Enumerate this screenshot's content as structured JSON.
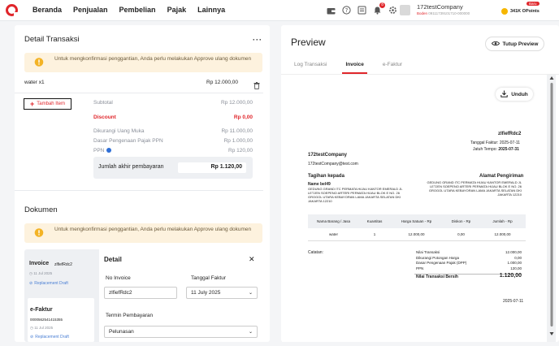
{
  "nav": [
    "Beranda",
    "Penjualan",
    "Pembelian",
    "Pajak",
    "Lainnya"
  ],
  "topbar": {
    "notif_count": "8",
    "company_name": "172testCompany",
    "company_role": "Boden",
    "company_id": "09111739101710-000000",
    "points": "341K OPoints",
    "new_badge": "Baru"
  },
  "left": {
    "title": "Detail Transaksi",
    "menu": "···",
    "alert1": "Untuk mengkonfirmasi penggantian, Anda perlu melakukan Approve ulang dokumen",
    "item_name": "water  x1",
    "item_price": "Rp 12.000,00",
    "add_item": "Tambah Item",
    "summary": [
      {
        "label": "Subtotal",
        "value": "Rp 12.000,00",
        "red": false
      },
      {
        "label": "Discount",
        "value": "Rp 0,00",
        "red": true
      },
      {
        "label": "Dikurangi Uang Muka",
        "value": "Rp 11.000,00",
        "red": false
      },
      {
        "label": "Dasar Pengenaan Pajak PPN",
        "value": "Rp 1.000,00",
        "red": false
      },
      {
        "label": "PPN",
        "value": "Rp 120,00",
        "red": false
      }
    ],
    "total_label": "Jumlah akhir pembayaran",
    "total_value": "Rp 1.120,00",
    "dokumen_title": "Dokumen",
    "alert2": "Untuk mengkonfirmasi penggantian, Anda perlu melakukan Approve ulang dokumen",
    "invoice_label": "Invoice",
    "invoice_code": "zlfiefRdc2",
    "invoice_date": "11 Jul 2025",
    "replacement": "Replacement Draft",
    "efaktur_label": "e-Faktur",
    "efaktur_no": "0000562541415355",
    "efaktur_date": "11 Jul 2025",
    "detail_title": "Detail",
    "no_invoice_label": "No Invoice",
    "no_invoice_value": "zlfiefRdc2",
    "tgl_faktur_label": "Tanggal Faktur",
    "tgl_faktur_value": "11 July 2025",
    "termin_label": "Termin Pembayaran",
    "termin_value": "Pelunasan"
  },
  "right": {
    "title": "Preview",
    "tutup": "Tutup Preview",
    "tabs": [
      "Log Transaksi",
      "Invoice",
      "e-Faktur"
    ],
    "unduh": "Unduh",
    "doc": {
      "inv_no": "zlfiefRdc2",
      "tgl_faktur": "Tanggal Faktur: 2025-07-11",
      "jatuh_tempo_label": "Jatuh Tempo:",
      "jatuh_tempo": "2025-07-31",
      "company": "172testCompany",
      "email": "172testCompany@test.com",
      "tagihan_label": "Tagihan kepada",
      "alamat_label": "Alamat Pengiriman",
      "buyer_name": "Name bel49",
      "buyer_addr": "GEDUNG GRAND ITC PERMATA HIJAU KANTOR EMERALD JL LETJEN SOEPENO ARTERI PERMATA HIJAU BLOK E NO. 26 GROGOL UTARA KEBAYORAN LAMA JAKARTA SELATAN DKI JAKARTA 12210",
      "ship_addr": "GEDUNG GRAND ITC PERMATA HIJAU KANTOR EMERALD JL LETJEN SOEPENO ARTERI PERMATA HIJAU BLOK E NO. 26 GROGOL UTARA KEBAYORAN LAMA JAKARTA SELATAN DKI JAKARTA 12210",
      "table_headers": [
        "Nama Barang / Jasa",
        "Kuantitas",
        "Harga Satuan - Rp",
        "Diskon - Rp",
        "Jumlah - Rp"
      ],
      "table_rows": [
        [
          "water",
          "1",
          "12.000,00",
          "0,00",
          "12.000,00"
        ]
      ],
      "catatan": "Catatan:",
      "totals": [
        {
          "label": "Nilai Transaksi",
          "value": "12.000,00"
        },
        {
          "label": "Dikurangi Potongan Harga",
          "value": "0,00"
        },
        {
          "label": "Dasar Pengenaan Pajak (DPP)",
          "value": "1.000,00"
        },
        {
          "label": "PPN",
          "value": "120,00"
        }
      ],
      "bersih_label": "Nilai Transaksi Bersih",
      "bersih_value": "1.120,00",
      "footer_date": "2025-07-11"
    }
  },
  "colors": {
    "accent": "#e0262b",
    "alert_bg": "#fdf2de",
    "link": "#4a7fd4"
  }
}
